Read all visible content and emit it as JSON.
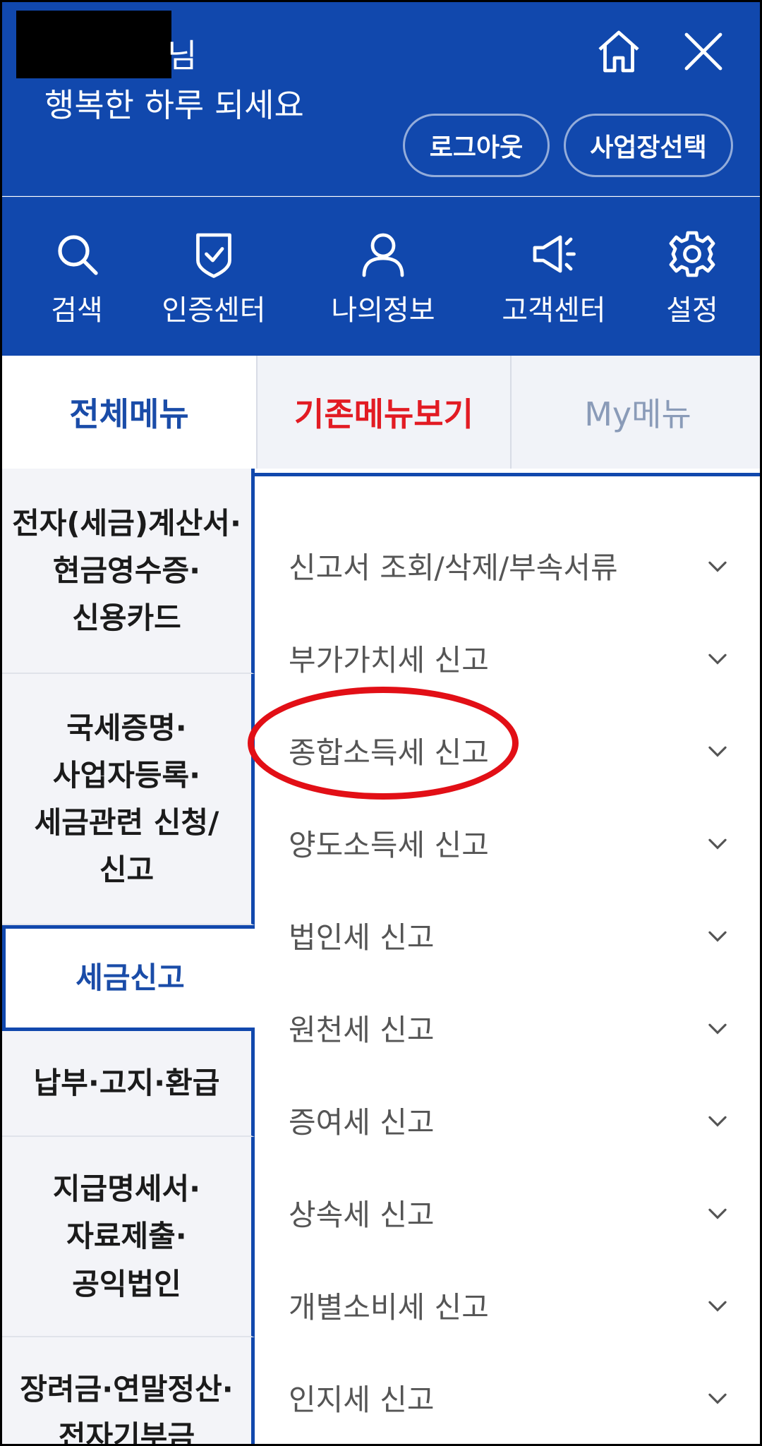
{
  "header": {
    "user_suffix": "님",
    "greeting": "행복한 하루 되세요",
    "logout_label": "로그아웃",
    "select_business_label": "사업장선택",
    "icons": [
      "home-icon",
      "close-icon"
    ]
  },
  "quick_menu": [
    {
      "label": "검색",
      "icon": "search-icon"
    },
    {
      "label": "인증센터",
      "icon": "shield-check-icon"
    },
    {
      "label": "나의정보",
      "icon": "user-icon"
    },
    {
      "label": "고객센터",
      "icon": "megaphone-icon"
    },
    {
      "label": "설정",
      "icon": "gear-icon"
    }
  ],
  "tabs": {
    "all": "전체메뉴",
    "old": "기존메뉴보기",
    "my": "My메뉴"
  },
  "categories": [
    {
      "label": "전자(세금)계산서·\n현금영수증·\n신용카드"
    },
    {
      "label": "국세증명·\n사업자등록·\n세금관련 신청/\n신고"
    },
    {
      "label": "세금신고"
    },
    {
      "label": "납부·고지·환급"
    },
    {
      "label": "지급명세서·\n자료제출·\n공익법인"
    },
    {
      "label": "장려금·연말정산·\n전자기부금"
    }
  ],
  "submenu": [
    {
      "label": "신고서 조회/삭제/부속서류"
    },
    {
      "label": "부가가치세 신고"
    },
    {
      "label": "종합소득세 신고"
    },
    {
      "label": "양도소득세 신고"
    },
    {
      "label": "법인세 신고"
    },
    {
      "label": "원천세 신고"
    },
    {
      "label": "증여세 신고"
    },
    {
      "label": "상속세 신고"
    },
    {
      "label": "개별소비세 신고"
    },
    {
      "label": "인지세 신고"
    }
  ],
  "colors": {
    "brand_blue": "#1148ad",
    "accent_red": "#e21b23",
    "text_blue": "#1a4ca8"
  }
}
